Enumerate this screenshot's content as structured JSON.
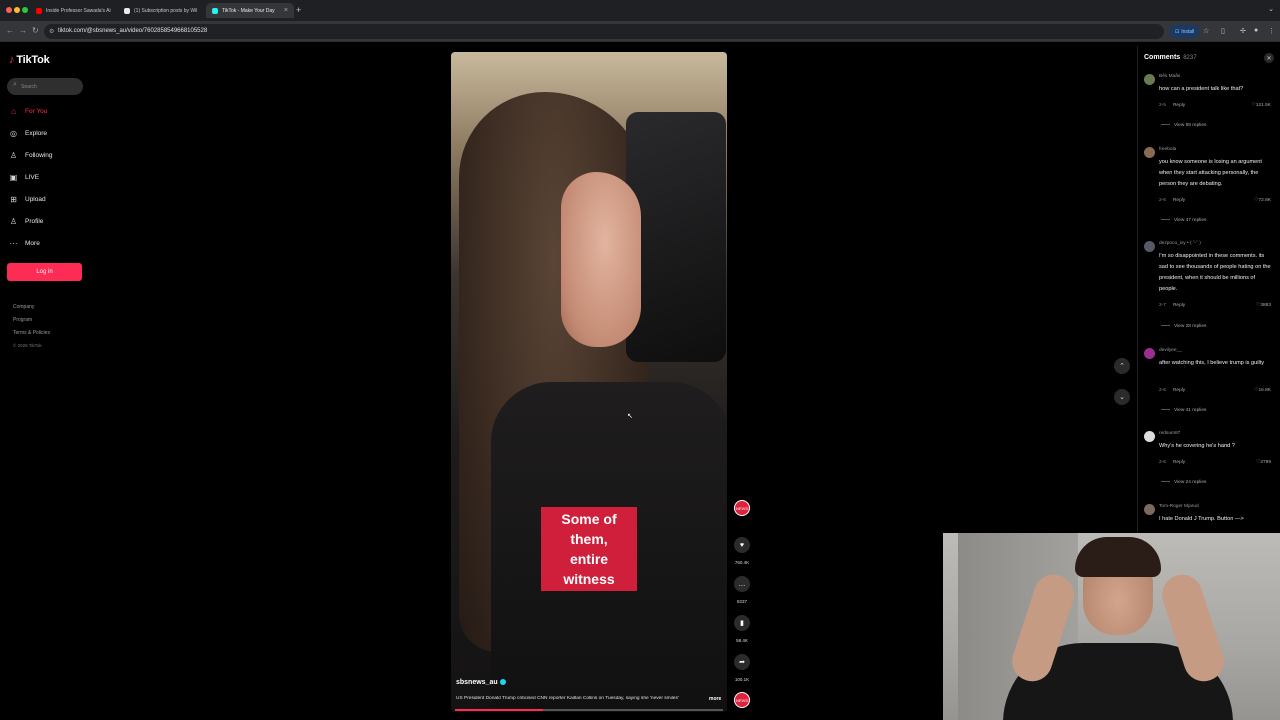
{
  "browser": {
    "tabs": [
      {
        "title": "Inside Professor Sawada's Ai",
        "favicon_color": "#ff0000"
      },
      {
        "title": "(1) Subscription posts by Wil",
        "favicon_color": "#e8eaed"
      },
      {
        "title": "TikTok - Make Your Day",
        "favicon_color": "#25f4ee"
      }
    ],
    "url": "tiktok.com/@sbsnews_au/video/7602858549668105528",
    "install_label": "Install"
  },
  "tiktok": {
    "logo": "TikTok",
    "search_placeholder": "Search",
    "nav": [
      {
        "label": "For You",
        "icon": "home-icon",
        "glyph": "⌂"
      },
      {
        "label": "Explore",
        "icon": "compass-icon",
        "glyph": "◎"
      },
      {
        "label": "Following",
        "icon": "person-icon",
        "glyph": "♙"
      },
      {
        "label": "LIVE",
        "icon": "live-icon",
        "glyph": "▣"
      },
      {
        "label": "Upload",
        "icon": "upload-icon",
        "glyph": "⊞"
      },
      {
        "label": "Profile",
        "icon": "profile-icon",
        "glyph": "♙"
      },
      {
        "label": "More",
        "icon": "more-icon",
        "glyph": "···"
      }
    ],
    "login_label": "Log in",
    "footer": [
      "Company",
      "Program",
      "Terms & Policies",
      "© 2026 TikTok"
    ]
  },
  "video": {
    "caption_line1": "Some of them,",
    "caption_line2": "entire witness",
    "author": "sbsnews_au",
    "description": "US President Donald Trump criticised CNN reporter Kaitlan Collins on Tuesday, saying she 'never smiles'",
    "more_label": "more",
    "progress": 0.33,
    "actions": {
      "likes": "760.4K",
      "comments": "8237",
      "saves": "58.4K",
      "shares": "100.1K"
    },
    "badge_label": "NEWS"
  },
  "comments": {
    "title": "Comments",
    "count": "8237",
    "items": [
      {
        "user": "Bês Maâs",
        "text": "how can a president talk like that?",
        "age": "2-5",
        "likes": "121.5K",
        "view": "View 58 replies",
        "avatar_color": "#6a7a55"
      },
      {
        "user": "freebola",
        "text": "you know someone is losing an argument when they start attacking personally, the person they are debating.",
        "age": "2-6",
        "likes": "72.8K",
        "view": "View 47 replies",
        "avatar_color": "#8a6a55"
      },
      {
        "user": "dezpoco_ivy • ( ˘ᵕ˘ )",
        "text": "I'm so disappointed in these comments. its sad to see thousands of people hating on the president, when it should be millions of people.",
        "age": "2-7",
        "likes": "3883",
        "view": "View 28 replies",
        "avatar_color": "#555a66"
      },
      {
        "user": "devilyee__",
        "text": "after watching this, I believe trump is guilty",
        "age": "2-6",
        "likes": "16.8K",
        "view": "View 41 replies",
        "avatar_color": "#9b2f8f"
      },
      {
        "user": "redsum87",
        "text": "Why's he covering he's hand ?",
        "age": "2-6",
        "likes": "2789",
        "view": "View 24 replies",
        "avatar_color": "#dddddd"
      },
      {
        "user": "Tom-Roger Mjarud",
        "text": "I hate Donald J Trump. Button —>",
        "age": "",
        "likes": "",
        "view": "",
        "avatar_color": "#7a6a60"
      }
    ]
  }
}
